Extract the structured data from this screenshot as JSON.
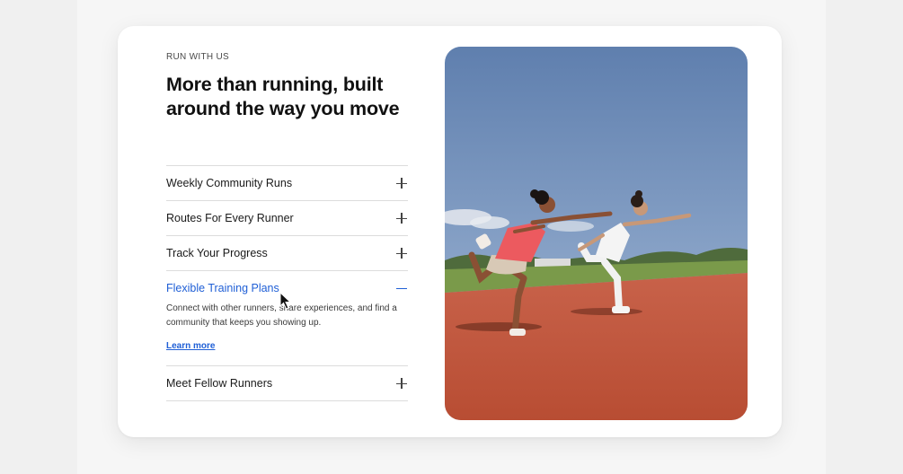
{
  "section": {
    "eyebrow": "RUN WITH US",
    "heading": "More than running, built around the way you move"
  },
  "accordion": {
    "items": [
      {
        "title": "Weekly Community Runs",
        "expanded": false,
        "icon": "plus-icon"
      },
      {
        "title": "Routes For Every Runner",
        "expanded": false,
        "icon": "plus-icon"
      },
      {
        "title": "Track Your Progress",
        "expanded": false,
        "icon": "plus-icon"
      },
      {
        "title": "Flexible Training Plans",
        "expanded": true,
        "icon": "minus-icon",
        "description": "Connect with other runners, share experiences, and find a community that keeps you showing up.",
        "link": "Learn more"
      },
      {
        "title": "Meet Fellow Runners",
        "expanded": false,
        "icon": "plus-icon"
      }
    ]
  },
  "colors": {
    "accent": "#1f5fd6",
    "text": "#111111",
    "divider": "#dcdcdc",
    "track": "#c45a3c",
    "sky": "#6f8fba"
  }
}
